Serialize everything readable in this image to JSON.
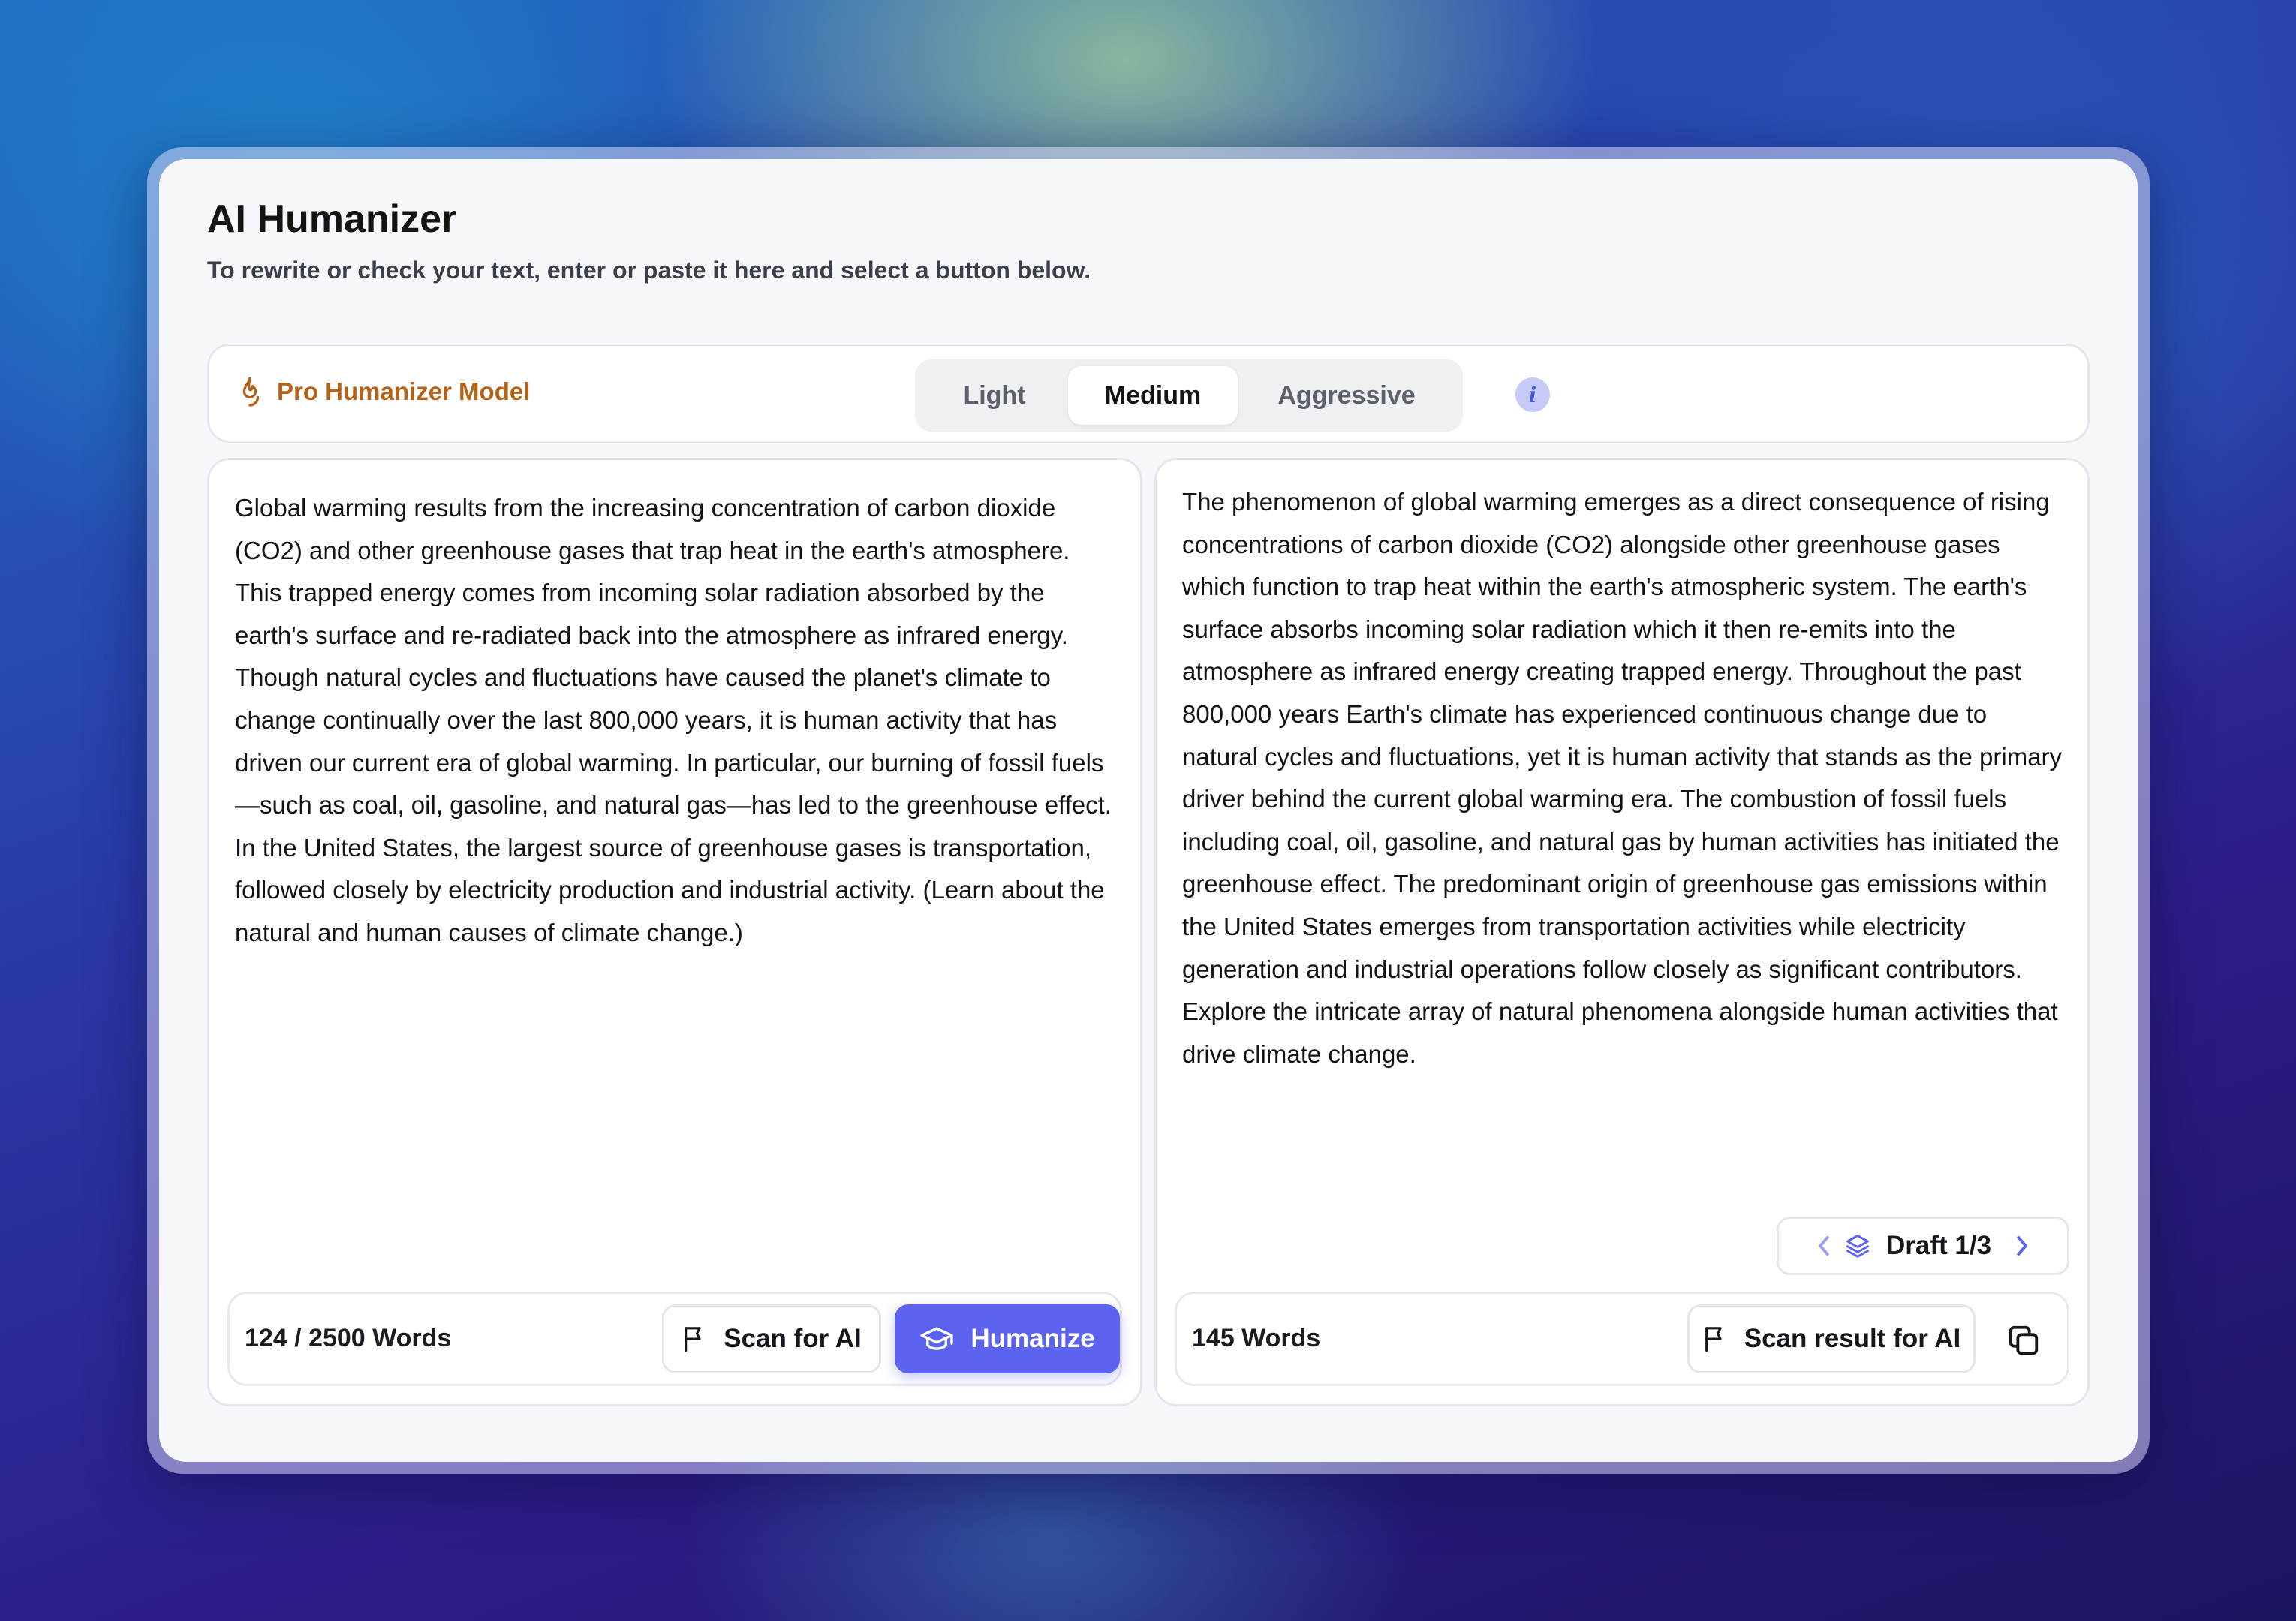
{
  "app": {
    "title": "AI Humanizer",
    "subtitle": "To rewrite or check your text, enter or paste it here and select a button below."
  },
  "toolbar": {
    "model_label": "Pro Humanizer Model",
    "model_icon": "flame-icon",
    "modes": [
      "Light",
      "Medium",
      "Aggressive"
    ],
    "selected_mode": "Medium",
    "info_glyph": "i"
  },
  "input": {
    "text": "Global warming results from the increasing concentration of carbon dioxide (CO2) and other greenhouse gases that trap heat in the earth's atmosphere. This trapped energy comes from incoming solar radiation absorbed by the earth's surface and re-radiated back into the atmosphere as infrared energy. Though natural cycles and fluctuations have caused the planet's climate to change continually over the last 800,000 years, it is human activity that has driven our current era of global warming. In particular, our burning of fossil fuels—such as coal, oil, gasoline, and natural gas—has led to the greenhouse effect. In the United States, the largest source of greenhouse gases is transportation, followed closely by electricity production and industrial activity. (Learn about the natural and human causes of climate change.)",
    "word_count": "124 / 2500 Words",
    "scan_label": "Scan for AI",
    "humanize_label": "Humanize"
  },
  "output": {
    "text": "The phenomenon of global warming emerges as a direct consequence of rising concentrations of carbon dioxide (CO2) alongside other greenhouse gases which function to trap heat within the earth's atmospheric system. The earth's surface absorbs incoming solar radiation which it then re-emits into the atmosphere as infrared energy creating trapped energy. Throughout the past 800,000 years Earth's climate has experienced continuous change due to natural cycles and fluctuations, yet it is human activity that stands as the primary driver behind the current global warming era. The combustion of fossil fuels including coal, oil, gasoline, and natural gas by human activities has initiated the greenhouse effect. The predominant origin of greenhouse gas emissions within the United States emerges from transportation activities while electricity generation and industrial operations follow closely as significant contributors. Explore the intricate array of natural phenomena alongside human activities that drive climate change.",
    "draft_label": "Draft 1/3",
    "word_count": "145 Words",
    "scan_label": "Scan result for AI"
  },
  "colors": {
    "accent": "#5b63f0",
    "model_label": "#b36218",
    "info_bg": "#c5cbf6"
  }
}
